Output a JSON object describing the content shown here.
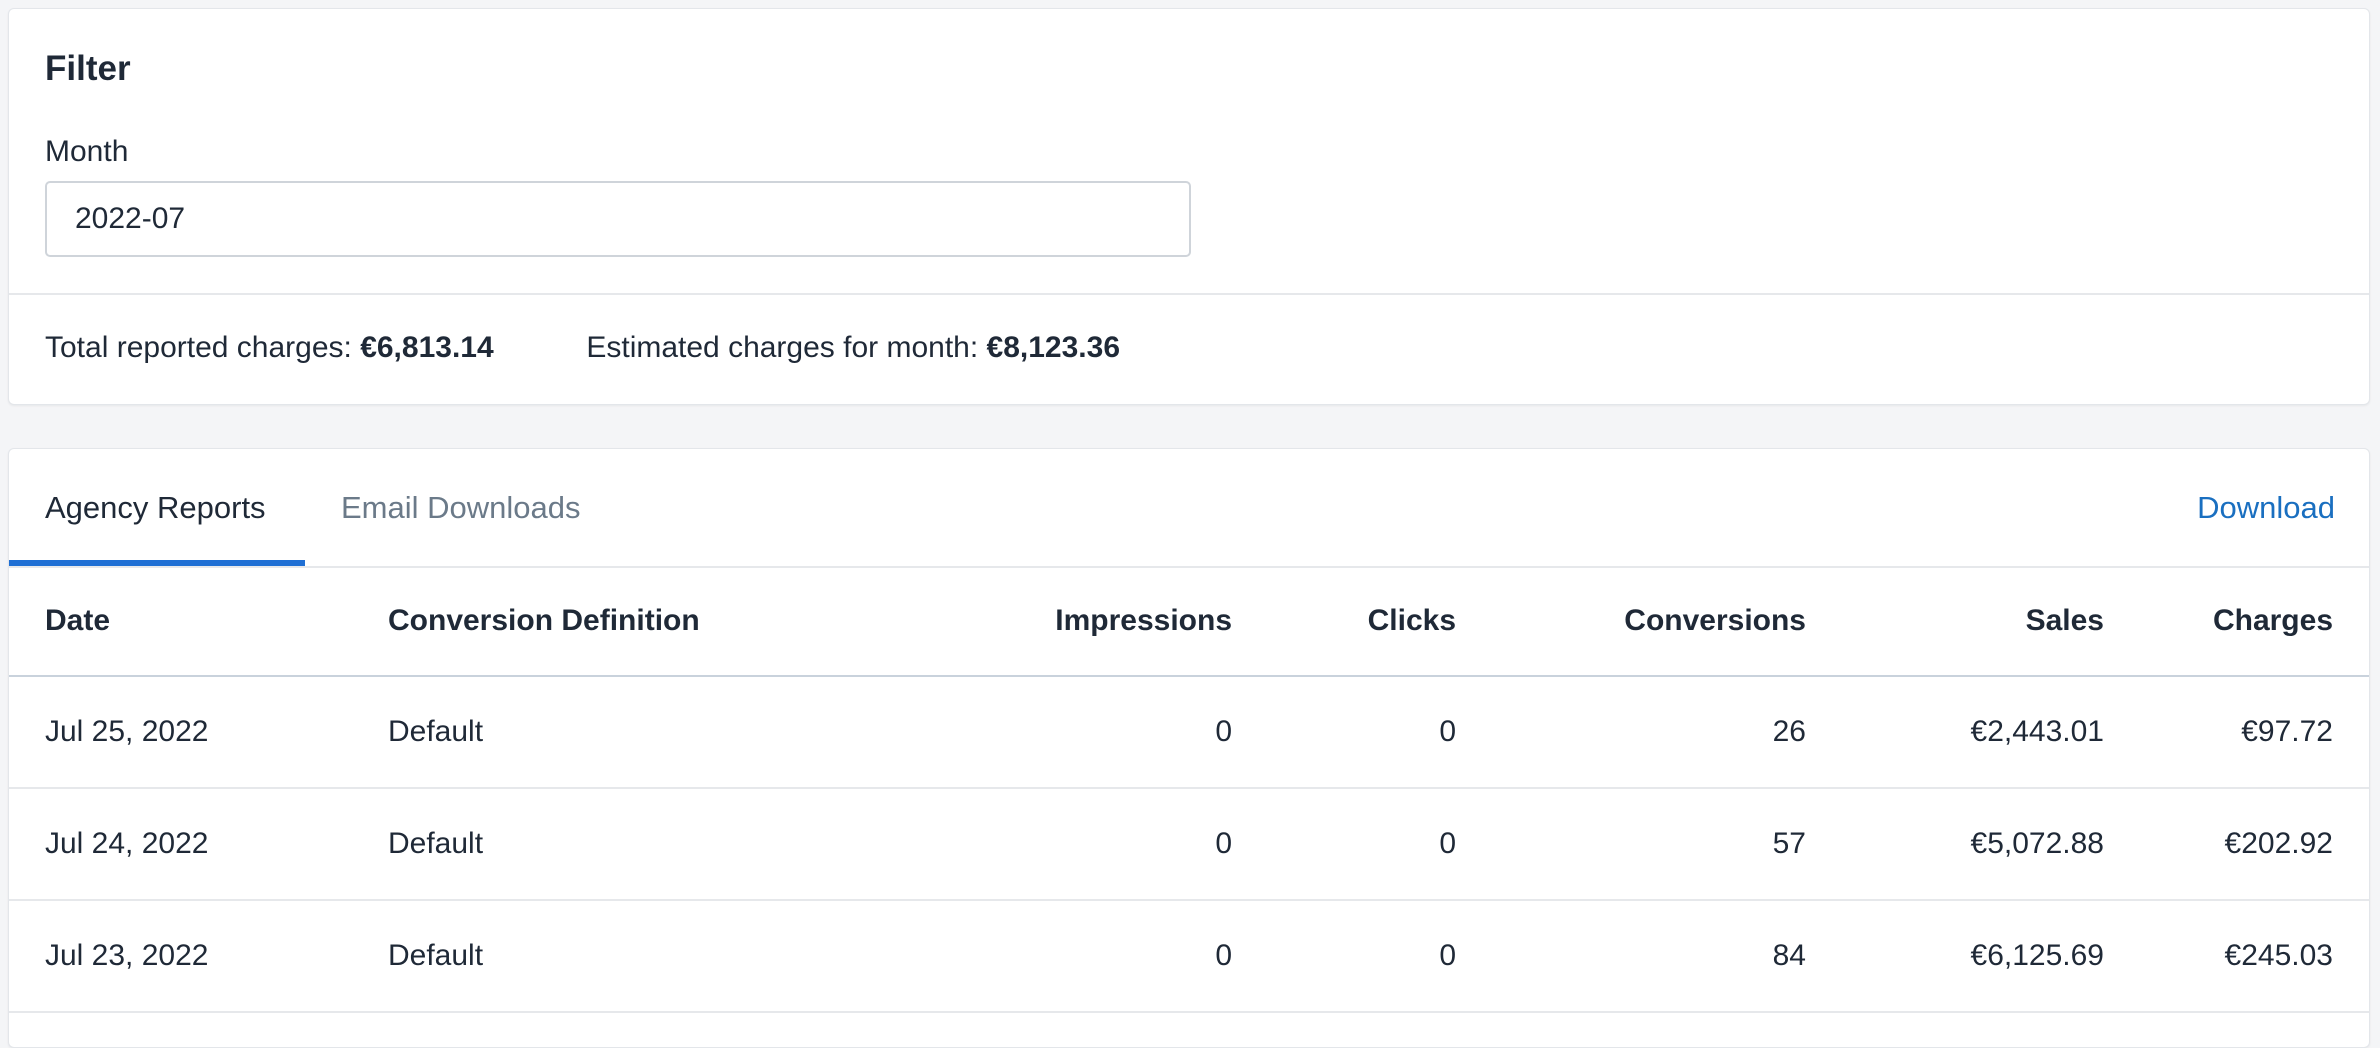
{
  "filter": {
    "title": "Filter",
    "month_label": "Month",
    "month_value": "2022-07"
  },
  "totals": {
    "reported_label": "Total reported charges:",
    "reported_value": "€6,813.14",
    "estimated_label": "Estimated charges for month:",
    "estimated_value": "€8,123.36"
  },
  "tabs": [
    {
      "label": "Agency Reports",
      "active": true
    },
    {
      "label": "Email Downloads",
      "active": false
    }
  ],
  "download_label": "Download",
  "table": {
    "columns": [
      "Date",
      "Conversion Definition",
      "Impressions",
      "Clicks",
      "Conversions",
      "Sales",
      "Charges"
    ],
    "rows": [
      [
        "Jul 25, 2022",
        "Default",
        "0",
        "0",
        "26",
        "€2,443.01",
        "€97.72"
      ],
      [
        "Jul 24, 2022",
        "Default",
        "0",
        "0",
        "57",
        "€5,072.88",
        "€202.92"
      ],
      [
        "Jul 23, 2022",
        "Default",
        "0",
        "0",
        "84",
        "€6,125.69",
        "€245.03"
      ]
    ]
  },
  "colors": {
    "accent": "#1f6fd4",
    "link": "#1a6fc0",
    "inactive_tab": "#6b7a89",
    "background": "#f4f5f7"
  }
}
